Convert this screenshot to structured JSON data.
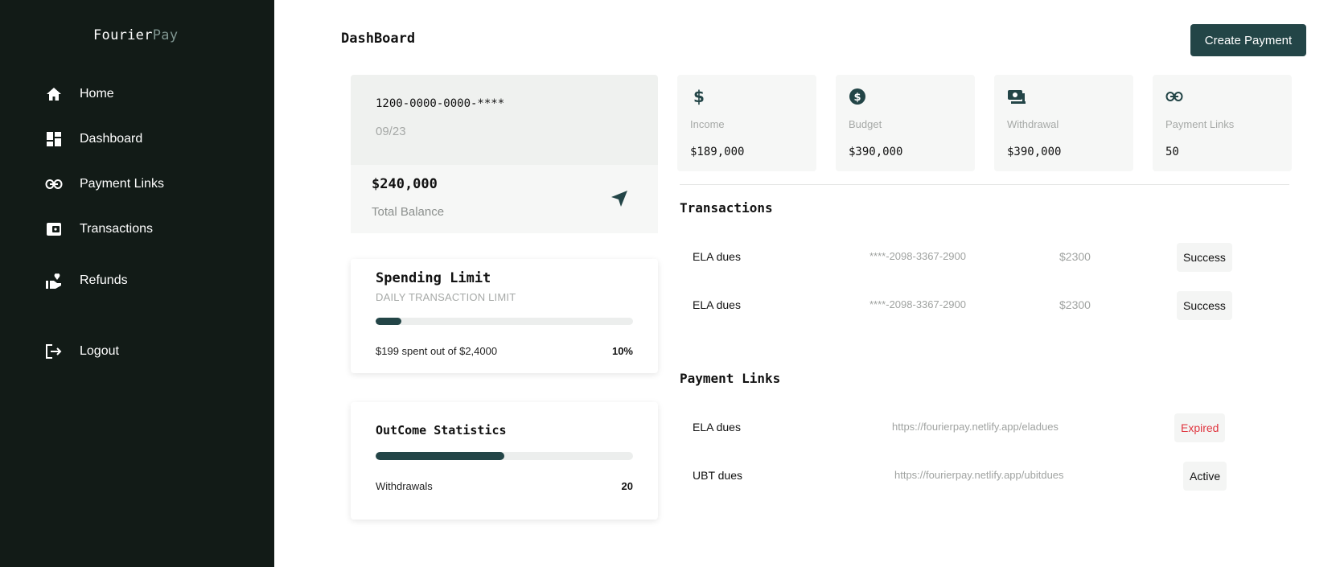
{
  "brand": {
    "name_main": "Fourier",
    "name_accent": "Pay"
  },
  "sidebar": {
    "items": [
      {
        "label": "Home",
        "icon": "home-icon"
      },
      {
        "label": "Dashboard",
        "icon": "dashboard-icon"
      },
      {
        "label": "Payment Links",
        "icon": "link-icon"
      },
      {
        "label": "Transactions",
        "icon": "wallet-icon"
      },
      {
        "label": "Refunds",
        "icon": "refund-hand-icon"
      },
      {
        "label": "Logout",
        "icon": "logout-icon"
      }
    ]
  },
  "header": {
    "title": "DashBoard",
    "create_button": "Create Payment"
  },
  "card": {
    "number": "1200-0000-0000-****",
    "expiry": "09/23",
    "balance": "$240,000",
    "balance_label": "Total Balance"
  },
  "spending_limit": {
    "title": "Spending Limit",
    "subtitle": "DAILY TRANSACTION LIMIT",
    "summary": "$199 spent out of $2,4000",
    "percent_label": "10%",
    "progress": 0.1
  },
  "outcome": {
    "title": "OutCome Statistics",
    "label": "Withdrawals",
    "value": "20",
    "progress": 0.5
  },
  "stats": [
    {
      "label": "Income",
      "value": "$189,000",
      "icon": "dollar-icon"
    },
    {
      "label": "Budget",
      "value": "$390,000",
      "icon": "dollar-circle-icon"
    },
    {
      "label": "Withdrawal",
      "value": "$390,000",
      "icon": "cash-icon"
    },
    {
      "label": "Payment Links",
      "value": "50",
      "icon": "link-icon"
    }
  ],
  "transactions": {
    "title": "Transactions",
    "rows": [
      {
        "name": "ELA dues",
        "card": "****-2098-3367-2900",
        "amount": "$2300",
        "status": "Success"
      },
      {
        "name": "ELA dues",
        "card": "****-2098-3367-2900",
        "amount": "$2300",
        "status": "Success"
      }
    ]
  },
  "payment_links": {
    "title": "Payment Links",
    "rows": [
      {
        "name": "ELA dues",
        "url": "https://fourierpay.netlify.app/eladues",
        "status": "Expired",
        "status_color": "#e0353f"
      },
      {
        "name": "UBT dues",
        "url": "https://fourierpay.netlify.app/ubitdues",
        "status": "Active",
        "status_color": "#111111"
      }
    ]
  },
  "colors": {
    "sidebar_bg": "#121b17",
    "accent": "#234547"
  }
}
